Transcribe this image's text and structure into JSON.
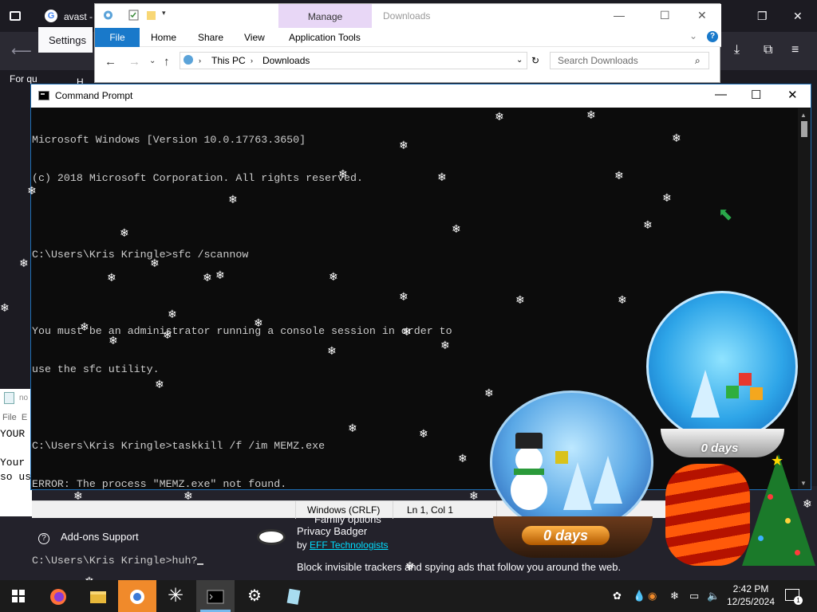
{
  "firefox": {
    "tab_title": "avast - G",
    "settings_tab": "Settings",
    "bookmark_text": "For qu",
    "bookmark_text2": "H",
    "addons_support": "Add-ons Support",
    "family_options": "Family options",
    "extension_name": "Privacy Badger",
    "extension_by": "by",
    "extension_author": "EFF Technologists",
    "extension_desc": "Block invisible trackers and spying ads that follow you around the web."
  },
  "notepad": {
    "title": "no",
    "menu_file": "File",
    "menu_edit": "E",
    "lines": [
      "YOUR",
      "Your",
      "so us"
    ],
    "status_encoding": "Windows (CRLF)",
    "status_position": "Ln 1, Col 1"
  },
  "explorer": {
    "manage_tab": "Manage",
    "window_title": "Downloads",
    "ribbon": {
      "file": "File",
      "home": "Home",
      "share": "Share",
      "view": "View",
      "app_tools": "Application Tools"
    },
    "breadcrumb": [
      "This PC",
      "Downloads"
    ],
    "search_placeholder": "Search Downloads",
    "help": "?"
  },
  "cmd": {
    "title": "Command Prompt",
    "lines": [
      "Microsoft Windows [Version 10.0.17763.3650]",
      "(c) 2018 Microsoft Corporation. All rights reserved.",
      "",
      "C:\\Users\\Kris Kringle>sfc /scannow",
      "",
      "You must be an administrator running a console session in order to",
      "use the sfc utility.",
      "",
      "C:\\Users\\Kris Kringle>taskkill /f /im MEMZ.exe",
      "ERROR: The process \"MEMZ.exe\" not found.",
      "",
      "C:\\Users\\Kris Kringle>huh?"
    ]
  },
  "globes": {
    "big_label": "0 days",
    "small_label": "0 days"
  },
  "taskbar": {
    "time": "2:42 PM",
    "date": "12/25/2024",
    "notification_count": "1",
    "items": [
      "start-button",
      "firefox",
      "file-explorer",
      "avast",
      "snowflake-app",
      "command-prompt",
      "settings",
      "notepad"
    ]
  },
  "colors": {
    "cmd_bg": "#0c0c0c",
    "cmd_text": "#cccccc",
    "manage_tab": "#e8d7f6",
    "file_tab": "#1979ca",
    "link": "#00ddff",
    "taskbar_bg": "#1b1b1b"
  }
}
